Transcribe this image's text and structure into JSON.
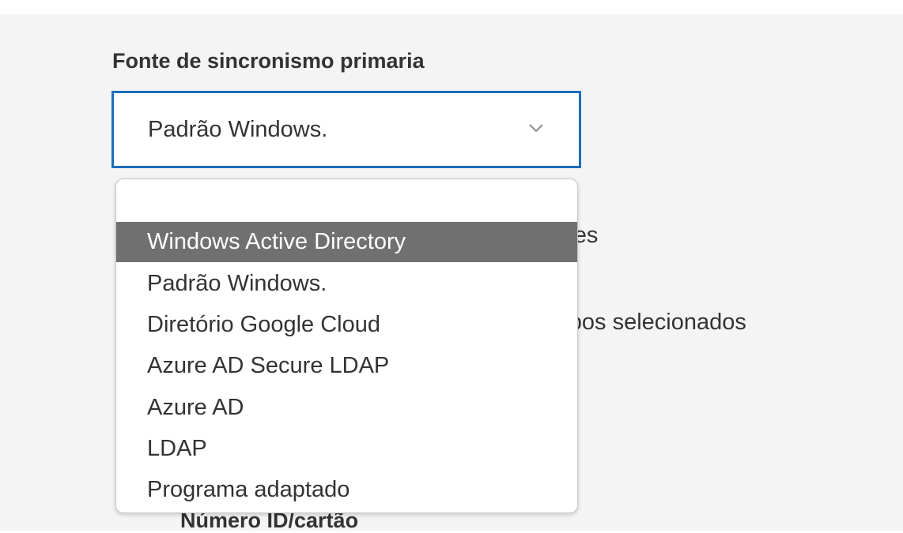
{
  "field": {
    "label": "Fonte de sincronismo primaria",
    "selected_value": "Padrão Windows.",
    "chevron_icon": "chevron-down-icon",
    "border_color": "#1a6fbd"
  },
  "background_fragments": {
    "text1": "ores",
    "text2": "rupos selecionados",
    "text3": "Número ID/cartão"
  },
  "dropdown": {
    "highlight_color": "#707070",
    "options": [
      {
        "label": ""
      },
      {
        "label": "Windows Active Directory",
        "highlighted": true
      },
      {
        "label": "Padrão Windows."
      },
      {
        "label": "Diretório Google Cloud"
      },
      {
        "label": "Azure AD Secure LDAP"
      },
      {
        "label": "Azure AD"
      },
      {
        "label": "LDAP"
      },
      {
        "label": "Programa adaptado"
      }
    ]
  }
}
